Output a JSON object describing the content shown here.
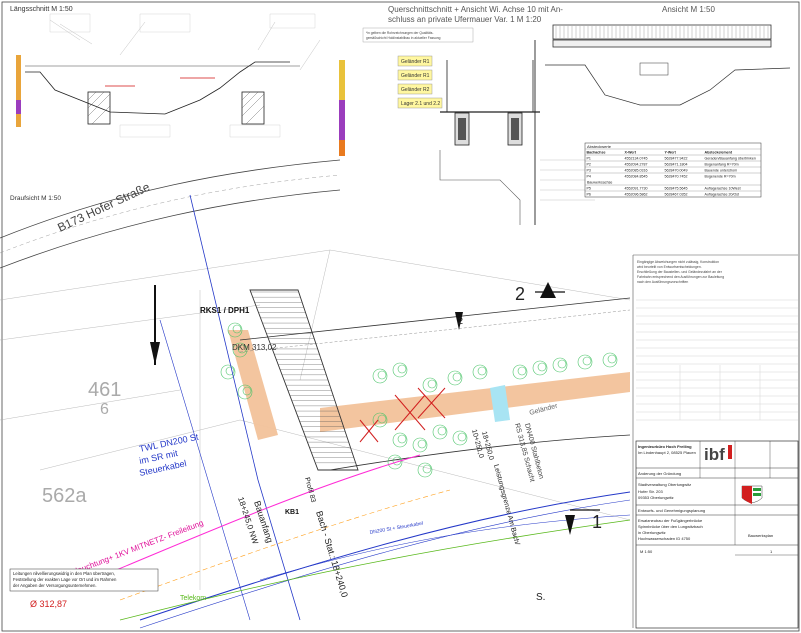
{
  "titles": {
    "laengsschnitt": "Längsschnitt  M 1:50",
    "querschnitt_1": "Querschnittschnitt + Ansicht Wi. Achse 10 mit An-",
    "querschnitt_2": "schluss an private Ufermauer Var. 1    M 1:20",
    "ansicht": "Ansicht  M 1:50",
    "draufsicht": "Draufsicht  M 1:50"
  },
  "labels": {
    "b173": "B173 Hofer Straße",
    "rks": "RKS1 / DPH1",
    "dkm": "DKM 313,02",
    "parcel_461": "461",
    "parcel_6": "6",
    "parcel_562a": "562a",
    "twl_1": "TWL DN200 St",
    "twl_2": "im SR mit",
    "twl_3": "Steuerkabel",
    "beleuchtung": "Beleuchtung+ 1KV MITNETZ- Freileitung",
    "dn200_kabel": "DN200 St + Steuerkabel",
    "telekom": "Telekom",
    "kb1": "KB1",
    "bach": "Bach - Stat.: 18+240,0",
    "bauanfang_1": "Bauanfang",
    "bauanfang_2": "18+245,0 NW",
    "profil": "Profil 83",
    "dn400_1": "DN400 Stahlbeton",
    "dn400_2": "RS 313,85 Schacht",
    "grenze": "Leistungsgrenze Am Bach/",
    "stat_18": "18+250,0",
    "stat_10": "10+251,0",
    "gelaender": "Geländer",
    "s_label": "S.",
    "elevation": "Ø 312,87",
    "section_2": "2",
    "section_1": "1",
    "section_marker_2": "2"
  },
  "notes": {
    "top_center_1": "*in gelben die Rohrzeichnungen der Qualitäts-",
    "top_center_2": "gemäßschicht Holdinstabilbau in aktueller Fassung",
    "bottom_left_1": "Leitungen nilvellierungswidrig in den Plan übertragen,",
    "bottom_left_2": "Feststellung der exakten Lage vor Ort und im Rahmen",
    "bottom_left_3": "der Angaben der Versorgungsunternehmen."
  },
  "rail_labels": {
    "g1": "Geländer R1",
    "g2": "Geländer R1",
    "g3": "Geländer R2",
    "g4": "Lager 2.1 und 2.2"
  },
  "coord_table": {
    "title": "Absteckwerte",
    "headers": [
      "Bachachse",
      "X-Wert",
      "Y-Wert",
      "Absteckelement"
    ],
    "rows": [
      [
        "P1",
        "4552134.0745",
        "5628477.9422",
        "Geraden/Bauanfang übertrinken"
      ],
      [
        "P2",
        "4552094.2787",
        "5628471.1804",
        "Bogenanfang R=70m"
      ],
      [
        "P3",
        "4552085.0316",
        "5628470.0049",
        "Bauende unterstrom"
      ],
      [
        "P4",
        "4552084.8545",
        "5628470.7452",
        "Bogenende R=70m"
      ]
    ],
    "section2": "Bauwerksachse",
    "rows2": [
      [
        "P5",
        "4552091.7730",
        "5628475.5645",
        "Auflagerachse 10West"
      ],
      [
        "P6",
        "4552096.5862",
        "5628467.0352",
        "Auflagerachse 20/Ost"
      ]
    ]
  },
  "titleblock": {
    "company": "Ingenieurbüro Hoch Freiling",
    "company_addr": "Im Lindenhaupt 2, 08525 Plauen",
    "logo_text": "ibf",
    "row_header": "Änderung der Gründung",
    "client_1": "Stadtverwaltung Oberlungwitz",
    "client_2": "Hofer Str. 203",
    "client_3": "09353 Oberlungwitz",
    "phase": "Entwurfs- und Genehmigungsplanung",
    "project_1": "Ersatzneubau der Fußgängerbrücke",
    "project_2": "Spinnbrücke über den Lungwitzbach",
    "project_3": "in Oberlungwitz",
    "project_4": "Hochwasserschaden ID 4750",
    "plan_type": "Bauwerksplan",
    "scale": "M 1:50",
    "sheet": "1"
  },
  "legend_notes": [
    "Eingängige Abweichungen nicht zulässig, Konstruktion",
    "wird beurteilt von Entwurfsentscheidungen.",
    "Erschließung der Baustellen- und Geländezufahrt an der",
    "Fahrbahn entsprechend den Ausführungen zur Bauleitung",
    "nach den Ausführungsvorschriften"
  ],
  "chart_colors": {
    "orange": "#f2c29a",
    "green": "#7fd08a",
    "red": "#d21f1f",
    "blue": "#2438c8",
    "magenta": "#ff2bd6",
    "telekom": "#58b81a",
    "cyan": "#a8e4f3"
  }
}
